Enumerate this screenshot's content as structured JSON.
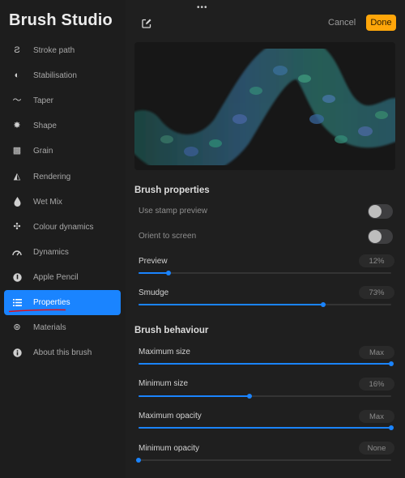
{
  "app": {
    "title": "Brush Studio"
  },
  "colors": {
    "accent": "#1a84ff",
    "done": "#ffa60a",
    "underline": "#e0101a"
  },
  "sidebar": {
    "items": [
      {
        "label": "Stroke path",
        "icon": "stroke-path-icon",
        "glyph": "Ƨ",
        "active": false
      },
      {
        "label": "Stabilisation",
        "icon": "stabilisation-icon",
        "glyph": "◐",
        "active": false
      },
      {
        "label": "Taper",
        "icon": "taper-icon",
        "glyph": "〜",
        "active": false
      },
      {
        "label": "Shape",
        "icon": "shape-icon",
        "glyph": "✸",
        "active": false
      },
      {
        "label": "Grain",
        "icon": "grain-icon",
        "glyph": "▩",
        "active": false
      },
      {
        "label": "Rendering",
        "icon": "rendering-icon",
        "glyph": "◭",
        "active": false
      },
      {
        "label": "Wet Mix",
        "icon": "wet-mix-icon",
        "glyph": "💧",
        "active": false
      },
      {
        "label": "Colour dynamics",
        "icon": "colour-dynamics-icon",
        "glyph": "✣",
        "active": false
      },
      {
        "label": "Dynamics",
        "icon": "dynamics-icon",
        "glyph": "◠",
        "active": false
      },
      {
        "label": "Apple Pencil",
        "icon": "apple-pencil-icon",
        "glyph": "●",
        "active": false
      },
      {
        "label": "Properties",
        "icon": "properties-icon",
        "glyph": "☰",
        "active": true
      },
      {
        "label": "Materials",
        "icon": "materials-icon",
        "glyph": "⊛",
        "active": false
      },
      {
        "label": "About this brush",
        "icon": "info-icon",
        "glyph": "ℹ",
        "active": false
      }
    ]
  },
  "header": {
    "more_glyph": "•••",
    "cancel_label": "Cancel",
    "done_label": "Done"
  },
  "properties": {
    "title": "Brush properties",
    "toggles": [
      {
        "label": "Use stamp preview",
        "on": false
      },
      {
        "label": "Orient to screen",
        "on": false
      }
    ],
    "sliders": [
      {
        "label": "Preview",
        "display": "12%",
        "value": 0.12
      },
      {
        "label": "Smudge",
        "display": "73%",
        "value": 0.73
      }
    ]
  },
  "behaviour": {
    "title": "Brush behaviour",
    "sliders": [
      {
        "label": "Maximum size",
        "display": "Max",
        "value": 1.0
      },
      {
        "label": "Minimum size",
        "display": "16%",
        "value": 0.44
      },
      {
        "label": "Maximum opacity",
        "display": "Max",
        "value": 1.0
      },
      {
        "label": "Minimum opacity",
        "display": "None",
        "value": 0.0
      }
    ]
  }
}
